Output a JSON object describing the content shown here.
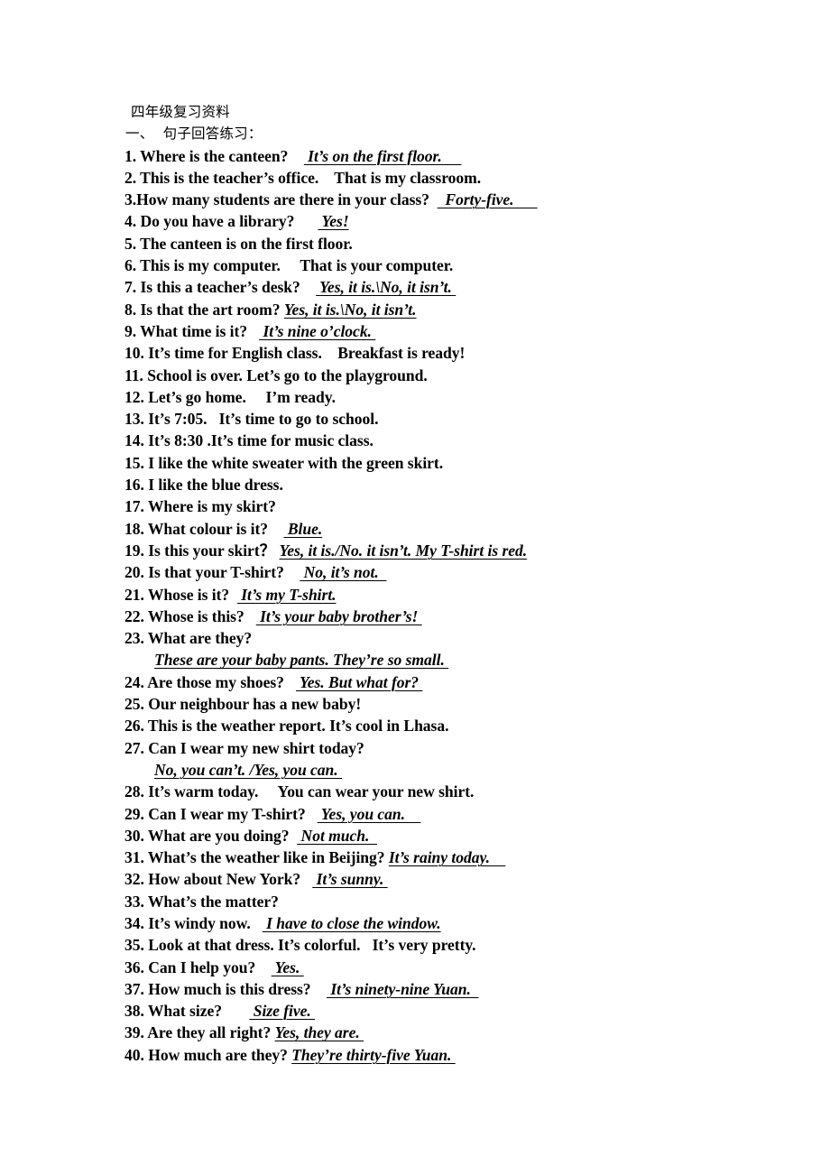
{
  "document": {
    "title": "四年级复习资料",
    "section_heading": "一、  句子回答练习：",
    "items": [
      {
        "num": "1. ",
        "question": "Where is the canteen?",
        "gap": "    ",
        "answer": " It’s on the first floor.     ",
        "underlined": true
      },
      {
        "num": "2. ",
        "question": "This is the teacher’s office.",
        "gap": "    ",
        "answer": "That is my classroom.",
        "underlined": false
      },
      {
        "num": "3.",
        "question": "How many students are there in your class?",
        "gap": "  ",
        "answer": "  Forty-five.      ",
        "underlined": true
      },
      {
        "num": "4. ",
        "question": "Do you have a library?",
        "gap": "      ",
        "answer": " Yes!",
        "underlined": true
      },
      {
        "num": "5. ",
        "question": "The canteen is on the first floor.",
        "gap": "",
        "answer": "",
        "underlined": false
      },
      {
        "num": "6. ",
        "question": "This is my computer.",
        "gap": "     ",
        "answer": "That is your computer.",
        "underlined": false
      },
      {
        "num": "7. ",
        "question": "Is this a teacher’s desk?",
        "gap": "    ",
        "answer": " Yes, it is.\\No, it isn’t. ",
        "underlined": true
      },
      {
        "num": "8. ",
        "question": "Is that the art room?",
        "gap": " ",
        "answer": "Yes, it is.\\No, it isn’t.",
        "underlined": true
      },
      {
        "num": "9. ",
        "question": "What time is it?",
        "gap": "   ",
        "answer": " It’s nine o’clock. ",
        "underlined": true
      },
      {
        "num": "10. ",
        "question": "It’s time for English class.",
        "gap": "    ",
        "answer": "Breakfast is ready!",
        "underlined": false
      },
      {
        "num": "11. ",
        "question": "School is over. Let’s go to the playground.",
        "gap": "",
        "answer": "",
        "underlined": false
      },
      {
        "num": "12. ",
        "question": "Let’s go home.",
        "gap": "     ",
        "answer": "I’m ready.",
        "underlined": false
      },
      {
        "num": "13. ",
        "question": "It’s 7:05.",
        "gap": "   ",
        "answer": "It’s time to go to school.",
        "underlined": false
      },
      {
        "num": "14. ",
        "question": "It’s 8:30 .It’s time for music class.",
        "gap": "",
        "answer": "",
        "underlined": false
      },
      {
        "num": "15. ",
        "question": "I like the white sweater with the green skirt.",
        "gap": "",
        "answer": "",
        "underlined": false
      },
      {
        "num": "16. ",
        "question": "I like the blue dress.",
        "gap": "",
        "answer": "",
        "underlined": false
      },
      {
        "num": "17. ",
        "question": "Where is my skirt?",
        "gap": "",
        "answer": "",
        "underlined": false
      },
      {
        "num": "18. ",
        "question": "What colour is it?",
        "gap": "    ",
        "answer": " Blue.",
        "underlined": true
      },
      {
        "num": "19. ",
        "question": "Is this your skirt？",
        "gap": " ",
        "answer": "Yes, it is./No. it isn’t. My T-shirt is red.",
        "underlined": true
      },
      {
        "num": "20. ",
        "question": "Is that your T-shirt?",
        "gap": "    ",
        "answer": " No, it’s not.  ",
        "underlined": true
      },
      {
        "num": "21. ",
        "question": "Whose is it?",
        "gap": "  ",
        "answer": " It’s my T-shirt.",
        "underlined": true
      },
      {
        "num": "22. ",
        "question": "Whose is this?",
        "gap": "   ",
        "answer": " It’s your baby brother’s! ",
        "underlined": true
      },
      {
        "num": "23. ",
        "question": "What are they?",
        "gap": "",
        "answer": "",
        "underlined": false
      },
      {
        "num": "24. ",
        "question": "Are those my shoes?",
        "gap": "   ",
        "answer": " Yes. But what for? ",
        "underlined": true
      },
      {
        "num": "25. ",
        "question": "Our neighbour has a new baby!",
        "gap": "",
        "answer": "",
        "underlined": false
      },
      {
        "num": "26. ",
        "question": "This is the weather report. It’s cool in Lhasa.",
        "gap": "",
        "answer": "",
        "underlined": false
      },
      {
        "num": "27. ",
        "question": "Can I wear my new shirt today?",
        "gap": "",
        "answer": "",
        "underlined": false
      },
      {
        "num": "28. ",
        "question": "It’s warm today.",
        "gap": "     ",
        "answer": "You can wear your new shirt.",
        "underlined": false
      },
      {
        "num": "29. ",
        "question": "Can I wear my T-shirt?",
        "gap": "   ",
        "answer": " Yes, you can.    ",
        "underlined": true
      },
      {
        "num": "30. ",
        "question": "What are you doing?",
        "gap": "  ",
        "answer": " Not much.  ",
        "underlined": true
      },
      {
        "num": "31. ",
        "question": "What’s the weather like in Beijing?",
        "gap": " ",
        "answer": "It’s rainy today.    ",
        "underlined": true
      },
      {
        "num": "32. ",
        "question": "How about New York?",
        "gap": "   ",
        "answer": " It’s sunny. ",
        "underlined": true
      },
      {
        "num": "33. ",
        "question": "What’s the matter?",
        "gap": "",
        "answer": "",
        "underlined": false
      },
      {
        "num": "34. ",
        "question": "It’s windy now.",
        "gap": "   ",
        "answer": " I have to close the window.",
        "underlined": true
      },
      {
        "num": "35. ",
        "question": "Look at that dress. It’s colorful.",
        "gap": "   ",
        "answer": "It’s very pretty.",
        "underlined": false
      },
      {
        "num": "36. ",
        "question": "Can I help you?",
        "gap": "    ",
        "answer": " Yes. ",
        "underlined": true
      },
      {
        "num": "37. ",
        "question": "How much is this dress?",
        "gap": "    ",
        "answer": " It’s ninety-nine Yuan.  ",
        "underlined": true
      },
      {
        "num": "38. ",
        "question": "What size?",
        "gap": "       ",
        "answer": " Size five. ",
        "underlined": true
      },
      {
        "num": "39. ",
        "question": "Are they all right?",
        "gap": " ",
        "answer": "Yes, they are. ",
        "underlined": true
      },
      {
        "num": "40. ",
        "question": "How much are they?",
        "gap": " ",
        "answer": "They’re thirty-five Yuan. ",
        "underlined": true
      }
    ],
    "continuations": {
      "after_23": "These are your baby pants. They’re so small. ",
      "after_27": "No, you can’t. /Yes, you can. "
    }
  }
}
